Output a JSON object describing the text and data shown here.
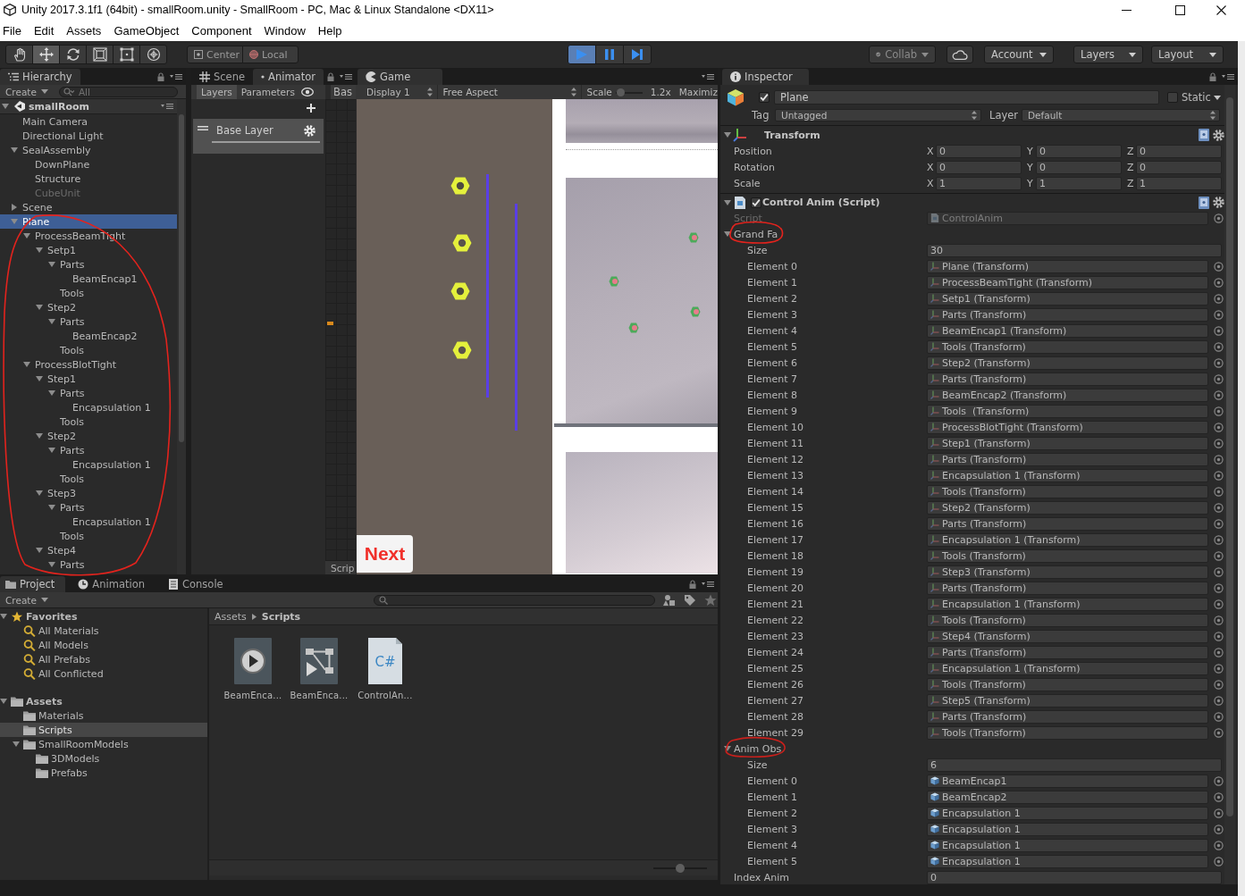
{
  "window": {
    "title": "Unity 2017.3.1f1 (64bit) - smallRoom.unity - SmallRoom - PC, Mac & Linux Standalone <DX11>"
  },
  "menu": [
    "File",
    "Edit",
    "Assets",
    "GameObject",
    "Component",
    "Window",
    "Help"
  ],
  "toolbar": {
    "tools": [
      {
        "kind": "hand",
        "selected": false
      },
      {
        "kind": "move",
        "selected": true
      },
      {
        "kind": "rotate",
        "selected": false
      },
      {
        "kind": "scale",
        "selected": false
      },
      {
        "kind": "rect",
        "selected": false
      },
      {
        "kind": "transform",
        "selected": false
      }
    ],
    "pivot": [
      {
        "kind": "pivot",
        "label": "Center"
      },
      {
        "kind": "space",
        "label": "Local"
      }
    ],
    "playback": [
      {
        "kind": "play",
        "on": true
      },
      {
        "kind": "pause",
        "on": false
      },
      {
        "kind": "step",
        "on": false
      }
    ],
    "right": [
      {
        "kind": "collab",
        "label": "Collab"
      },
      {
        "kind": "cloud"
      },
      {
        "kind": "account",
        "label": "Account"
      },
      {
        "kind": "layers",
        "label": "Layers"
      },
      {
        "kind": "layout",
        "label": "Layout"
      }
    ]
  },
  "hierarchy": {
    "tab": "Hierarchy",
    "create": "Create",
    "search": {
      "placeholder": "All"
    },
    "tree": [
      {
        "label": "smallRoom",
        "kind": "scene",
        "selected": false,
        "disabled": false,
        "expanded": true,
        "children": [
          {
            "label": "Main Camera",
            "selected": false,
            "disabled": false
          },
          {
            "label": "Directional Light",
            "selected": false,
            "disabled": false
          },
          {
            "label": "SealAssembly",
            "selected": false,
            "disabled": false,
            "expanded": true,
            "children": [
              {
                "label": "DownPlane",
                "selected": false,
                "disabled": false
              },
              {
                "label": "Structure",
                "selected": false,
                "disabled": false
              },
              {
                "label": "CubeUnit",
                "selected": false,
                "disabled": true
              }
            ]
          },
          {
            "label": "Scene",
            "selected": false,
            "disabled": false,
            "expanded": false
          },
          {
            "label": "Plane",
            "selected": true,
            "disabled": false,
            "expanded": true,
            "children": [
              {
                "label": "ProcessBeamTight",
                "selected": false,
                "disabled": false,
                "expanded": true,
                "children": [
                  {
                    "label": "Setp1",
                    "selected": false,
                    "disabled": false,
                    "expanded": true,
                    "children": [
                      {
                        "label": "Parts",
                        "selected": false,
                        "disabled": false,
                        "expanded": true,
                        "children": [
                          {
                            "label": "BeamEncap1",
                            "selected": false,
                            "disabled": false
                          }
                        ]
                      },
                      {
                        "label": "Tools",
                        "selected": false,
                        "disabled": false
                      }
                    ]
                  },
                  {
                    "label": "Step2",
                    "selected": false,
                    "disabled": false,
                    "expanded": true,
                    "children": [
                      {
                        "label": "Parts",
                        "selected": false,
                        "disabled": false,
                        "expanded": true,
                        "children": [
                          {
                            "label": "BeamEncap2",
                            "selected": false,
                            "disabled": false
                          }
                        ]
                      },
                      {
                        "label": "Tools",
                        "selected": false,
                        "disabled": false
                      }
                    ]
                  }
                ]
              },
              {
                "label": "ProcessBlotTight",
                "selected": false,
                "disabled": false,
                "expanded": true,
                "children": [
                  {
                    "label": "Step1",
                    "selected": false,
                    "disabled": false,
                    "expanded": true,
                    "children": [
                      {
                        "label": "Parts",
                        "selected": false,
                        "disabled": false,
                        "expanded": true,
                        "children": [
                          {
                            "label": "Encapsulation 1",
                            "selected": false,
                            "disabled": false
                          }
                        ]
                      },
                      {
                        "label": "Tools",
                        "selected": false,
                        "disabled": false
                      }
                    ]
                  },
                  {
                    "label": "Step2",
                    "selected": false,
                    "disabled": false,
                    "expanded": true,
                    "children": [
                      {
                        "label": "Parts",
                        "selected": false,
                        "disabled": false,
                        "expanded": true,
                        "children": [
                          {
                            "label": "Encapsulation 1",
                            "selected": false,
                            "disabled": false
                          }
                        ]
                      },
                      {
                        "label": "Tools",
                        "selected": false,
                        "disabled": false
                      }
                    ]
                  },
                  {
                    "label": "Step3",
                    "selected": false,
                    "disabled": false,
                    "expanded": true,
                    "children": [
                      {
                        "label": "Parts",
                        "selected": false,
                        "disabled": false,
                        "expanded": true,
                        "children": [
                          {
                            "label": "Encapsulation 1",
                            "selected": false,
                            "disabled": false
                          }
                        ]
                      },
                      {
                        "label": "Tools",
                        "selected": false,
                        "disabled": false
                      }
                    ]
                  },
                  {
                    "label": "Step4",
                    "selected": false,
                    "disabled": false,
                    "expanded": true,
                    "children": [
                      {
                        "label": "Parts",
                        "selected": false,
                        "disabled": false,
                        "expanded": true
                      }
                    ]
                  }
                ]
              }
            ]
          }
        ]
      }
    ]
  },
  "animator": {
    "tabs": [
      {
        "label": "Scene",
        "kind": "scene",
        "selected": false
      },
      {
        "label": "Animator",
        "kind": "animator",
        "selected": true
      }
    ],
    "subtabs": [
      {
        "label": "Layers",
        "selected": true
      },
      {
        "label": "Parameters",
        "selected": false
      }
    ],
    "breadcrumb": "Bas",
    "layers": [
      {
        "label": "Base Layer"
      }
    ],
    "footer": "Scrip"
  },
  "game": {
    "tab": "Game",
    "display": "Display 1",
    "aspect": "Free Aspect",
    "scale_label": "Scale",
    "scale": {
      "level": 0.05
    },
    "scale_value": "1.2x",
    "maximize": "Maximiz",
    "next_button": "Next"
  },
  "inspector": {
    "tab": "Inspector",
    "object": {
      "active": true,
      "name": "Plane",
      "static": false,
      "static_label": "Static",
      "tag_label": "Tag",
      "tag": "Untagged",
      "layer_label": "Layer",
      "layer": "Default"
    },
    "transform": {
      "title": "Transform",
      "expanded": true,
      "rows": [
        {
          "label": "Position",
          "values": [
            {
              "axis": "X",
              "value": "0"
            },
            {
              "axis": "Y",
              "value": "0"
            },
            {
              "axis": "Z",
              "value": "0"
            }
          ]
        },
        {
          "label": "Rotation",
          "values": [
            {
              "axis": "X",
              "value": "0"
            },
            {
              "axis": "Y",
              "value": "0"
            },
            {
              "axis": "Z",
              "value": "0"
            }
          ]
        },
        {
          "label": "Scale",
          "values": [
            {
              "axis": "X",
              "value": "1"
            },
            {
              "axis": "Y",
              "value": "1"
            },
            {
              "axis": "Z",
              "value": "1"
            }
          ]
        }
      ]
    },
    "script": {
      "title": "Control Anim (Script)",
      "enabled": true,
      "expanded": true,
      "script_field": {
        "label": "Script",
        "value": "ControlAnim",
        "disabled": true
      },
      "arrays": [
        {
          "label": "Grand Fa",
          "kind": "transform",
          "expanded": true,
          "size_label": "Size",
          "size": "30",
          "elements": [
            {
              "label": "Element 0",
              "value": "Plane (Transform)"
            },
            {
              "label": "Element 1",
              "value": "ProcessBeamTight (Transform)"
            },
            {
              "label": "Element 2",
              "value": "Setp1 (Transform)"
            },
            {
              "label": "Element 3",
              "value": "Parts (Transform)"
            },
            {
              "label": "Element 4",
              "value": "BeamEncap1 (Transform)"
            },
            {
              "label": "Element 5",
              "value": "Tools (Transform)"
            },
            {
              "label": "Element 6",
              "value": "Step2 (Transform)"
            },
            {
              "label": "Element 7",
              "value": "Parts (Transform)"
            },
            {
              "label": "Element 8",
              "value": "BeamEncap2 (Transform)"
            },
            {
              "label": "Element 9",
              "value": "Tools  (Transform)"
            },
            {
              "label": "Element 10",
              "value": "ProcessBlotTight (Transform)"
            },
            {
              "label": "Element 11",
              "value": "Step1 (Transform)"
            },
            {
              "label": "Element 12",
              "value": "Parts (Transform)"
            },
            {
              "label": "Element 13",
              "value": "Encapsulation 1 (Transform)"
            },
            {
              "label": "Element 14",
              "value": "Tools (Transform)"
            },
            {
              "label": "Element 15",
              "value": "Step2 (Transform)"
            },
            {
              "label": "Element 16",
              "value": "Parts (Transform)"
            },
            {
              "label": "Element 17",
              "value": "Encapsulation 1 (Transform)"
            },
            {
              "label": "Element 18",
              "value": "Tools (Transform)"
            },
            {
              "label": "Element 19",
              "value": "Step3 (Transform)"
            },
            {
              "label": "Element 20",
              "value": "Parts (Transform)"
            },
            {
              "label": "Element 21",
              "value": "Encapsulation 1 (Transform)"
            },
            {
              "label": "Element 22",
              "value": "Tools (Transform)"
            },
            {
              "label": "Element 23",
              "value": "Step4 (Transform)"
            },
            {
              "label": "Element 24",
              "value": "Parts (Transform)"
            },
            {
              "label": "Element 25",
              "value": "Encapsulation 1 (Transform)"
            },
            {
              "label": "Element 26",
              "value": "Tools (Transform)"
            },
            {
              "label": "Element 27",
              "value": "Step5 (Transform)"
            },
            {
              "label": "Element 28",
              "value": "Parts (Transform)"
            },
            {
              "label": "Element 29",
              "value": "Tools (Transform)"
            }
          ]
        },
        {
          "label": "Anim Obs",
          "kind": "object",
          "expanded": true,
          "size_label": "Size",
          "size": "6",
          "elements": [
            {
              "label": "Element 0",
              "value": "BeamEncap1"
            },
            {
              "label": "Element 1",
              "value": "BeamEncap2"
            },
            {
              "label": "Element 2",
              "value": "Encapsulation 1"
            },
            {
              "label": "Element 3",
              "value": "Encapsulation 1"
            },
            {
              "label": "Element 4",
              "value": "Encapsulation 1"
            },
            {
              "label": "Element 5",
              "value": "Encapsulation 1"
            }
          ]
        }
      ],
      "fields": [
        {
          "label": "Index Anim",
          "value": "0"
        }
      ]
    }
  },
  "project": {
    "tabs": [
      {
        "label": "Project",
        "kind": "project",
        "selected": true
      },
      {
        "label": "Animation",
        "kind": "animation",
        "selected": false
      },
      {
        "label": "Console",
        "kind": "console",
        "selected": false
      }
    ],
    "create": "Create",
    "tree": [
      {
        "label": "Favorites",
        "kind": "favorites",
        "selected": false,
        "expanded": true,
        "children": [
          {
            "label": "All Materials",
            "kind": "search",
            "selected": false
          },
          {
            "label": "All Models",
            "kind": "search",
            "selected": false
          },
          {
            "label": "All Prefabs",
            "kind": "search",
            "selected": false
          },
          {
            "label": "All Conflicted",
            "kind": "search",
            "selected": false
          }
        ]
      },
      {
        "label": "Assets",
        "kind": "folder",
        "selected": false,
        "expanded": true,
        "children": [
          {
            "label": "Materials",
            "kind": "folder",
            "selected": false
          },
          {
            "label": "Scripts",
            "kind": "folder",
            "selected": true
          },
          {
            "label": "SmallRoomModels",
            "kind": "folder",
            "selected": false,
            "expanded": true,
            "children": [
              {
                "label": "3DModels",
                "kind": "folder",
                "selected": false
              },
              {
                "label": "Prefabs",
                "kind": "folder",
                "selected": false
              }
            ]
          }
        ]
      }
    ],
    "breadcrumb": [
      "Assets",
      "Scripts"
    ],
    "assets": [
      {
        "label": "BeamEnca...",
        "kind": "clip"
      },
      {
        "label": "BeamEnca...",
        "kind": "controller"
      },
      {
        "label": "ControlAn...",
        "kind": "script",
        "badge": "C#"
      }
    ],
    "zoom": {
      "level": 0.5
    }
  }
}
